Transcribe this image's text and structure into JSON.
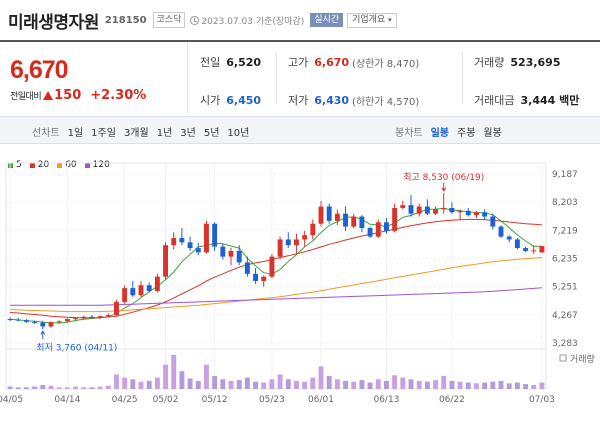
{
  "header": {
    "name": "미래생명자원",
    "code": "218150",
    "market": "코스닥",
    "date": "2023.07.03 기준(장마감)",
    "realtime_btn": "실시간",
    "company_btn": "기업개요"
  },
  "price": {
    "current": "6,670",
    "change_label": "전일대비",
    "change": "150",
    "change_pct": "+2.30%"
  },
  "stats": {
    "prev_close_label": "전일",
    "prev_close": "6,520",
    "high_label": "고가",
    "high": "6,670",
    "upper_limit_label": "(상한가",
    "upper_limit": "8,470)",
    "volume_label": "거래량",
    "volume": "523,695",
    "open_label": "시가",
    "open": "6,450",
    "low_label": "저가",
    "low": "6,430",
    "lower_limit_label": "(하한가",
    "lower_limit": "4,570)",
    "amount_label": "거래대금",
    "amount": "3,444 백만"
  },
  "tabs": {
    "line_label": "선차트",
    "line_tabs": [
      "1일",
      "1주일",
      "3개월",
      "1년",
      "3년",
      "5년",
      "10년"
    ],
    "candle_label": "봉차트",
    "candle_tabs": [
      "일봉",
      "주봉",
      "월봉"
    ]
  },
  "legend": [
    {
      "label": "5",
      "color": "#3aa63a"
    },
    {
      "label": "20",
      "color": "#d9342b"
    },
    {
      "label": "60",
      "color": "#f09a2a"
    },
    {
      "label": "120",
      "color": "#9b55d1"
    }
  ],
  "chart_data": {
    "type": "candlestick",
    "y_ticks": [
      "9,187",
      "8,203",
      "7,219",
      "6,235",
      "5,251",
      "4,267",
      "3,283"
    ],
    "y_range": [
      3283,
      9187
    ],
    "x_ticks": [
      "04/05",
      "04/14",
      "04/25",
      "05/02",
      "05/12",
      "05/23",
      "06/01",
      "06/13",
      "06/22",
      "07/03"
    ],
    "high_annotation": "최고 8,530 (06/19)",
    "low_annotation": "최저 3,760 (04/11)",
    "volume_label": "거래량",
    "up_color": "#d9342b",
    "down_color": "#1e61d2",
    "candles": [
      [
        4120,
        4180,
        4050,
        4100
      ],
      [
        4100,
        4160,
        4040,
        4080
      ],
      [
        4080,
        4120,
        3990,
        4020
      ],
      [
        4020,
        4070,
        3950,
        3990
      ],
      [
        3990,
        4060,
        3760,
        3860
      ],
      [
        3860,
        4040,
        3820,
        4010
      ],
      [
        4010,
        4080,
        3960,
        4040
      ],
      [
        4040,
        4150,
        4000,
        4120
      ],
      [
        4120,
        4180,
        4060,
        4150
      ],
      [
        4150,
        4230,
        4100,
        4200
      ],
      [
        4200,
        4260,
        4140,
        4180
      ],
      [
        4180,
        4240,
        4120,
        4220
      ],
      [
        4220,
        4320,
        4180,
        4260
      ],
      [
        4260,
        4800,
        4220,
        4720
      ],
      [
        4720,
        5300,
        4650,
        5200
      ],
      [
        5200,
        5450,
        4900,
        4950
      ],
      [
        4950,
        5450,
        4880,
        5300
      ],
      [
        5300,
        5400,
        5050,
        5100
      ],
      [
        5100,
        5700,
        5050,
        5600
      ],
      [
        5600,
        6800,
        5500,
        6700
      ],
      [
        6700,
        7150,
        6550,
        6950
      ],
      [
        6950,
        7300,
        6700,
        6800
      ],
      [
        6800,
        7000,
        6500,
        6600
      ],
      [
        6600,
        6780,
        6350,
        6450
      ],
      [
        6450,
        7550,
        6400,
        7450
      ],
      [
        7450,
        7500,
        6500,
        6650
      ],
      [
        6650,
        6750,
        6200,
        6300
      ],
      [
        6300,
        6600,
        6000,
        6500
      ],
      [
        6500,
        6700,
        6000,
        6100
      ],
      [
        6100,
        6300,
        5600,
        5700
      ],
      [
        5700,
        5900,
        5350,
        5450
      ],
      [
        5450,
        5650,
        5250,
        5600
      ],
      [
        5600,
        6400,
        5550,
        6300
      ],
      [
        6300,
        7000,
        6200,
        6900
      ],
      [
        6900,
        7150,
        6600,
        6700
      ],
      [
        6700,
        7100,
        6400,
        6900
      ],
      [
        6900,
        7200,
        6650,
        7050
      ],
      [
        7050,
        7600,
        6900,
        7450
      ],
      [
        7450,
        8250,
        7350,
        8050
      ],
      [
        8050,
        8150,
        7450,
        7550
      ],
      [
        7550,
        7950,
        7400,
        7800
      ],
      [
        7800,
        8050,
        7200,
        7350
      ],
      [
        7350,
        7800,
        7300,
        7700
      ],
      [
        7700,
        7750,
        7150,
        7300
      ],
      [
        7300,
        7350,
        6950,
        7000
      ],
      [
        7000,
        7600,
        6950,
        7500
      ],
      [
        7500,
        7650,
        7100,
        7200
      ],
      [
        7200,
        8150,
        7150,
        8000
      ],
      [
        8000,
        8250,
        7950,
        8100
      ],
      [
        8100,
        8450,
        7700,
        7800
      ],
      [
        7800,
        8150,
        7700,
        8050
      ],
      [
        8050,
        8300,
        7750,
        7800
      ],
      [
        7800,
        8050,
        7750,
        7950
      ],
      [
        7950,
        8530,
        7800,
        8000
      ],
      [
        8000,
        8200,
        7800,
        7850
      ],
      [
        7850,
        7950,
        7600,
        7900
      ],
      [
        7900,
        8000,
        7700,
        7750
      ],
      [
        7750,
        7900,
        7650,
        7850
      ],
      [
        7850,
        7950,
        7600,
        7700
      ],
      [
        7700,
        7800,
        7250,
        7350
      ],
      [
        7350,
        7400,
        6950,
        7000
      ],
      [
        7000,
        7050,
        6800,
        6900
      ],
      [
        6900,
        6950,
        6550,
        6600
      ],
      [
        6600,
        6650,
        6450,
        6500
      ],
      [
        6500,
        6700,
        6400,
        6520
      ],
      [
        6450,
        6670,
        6430,
        6670
      ]
    ],
    "volumes": [
      3,
      2,
      2,
      3,
      5,
      4,
      2,
      2,
      3,
      2,
      2,
      3,
      4,
      18,
      14,
      12,
      9,
      10,
      14,
      30,
      42,
      22,
      13,
      10,
      30,
      16,
      12,
      10,
      11,
      14,
      9,
      8,
      12,
      18,
      12,
      10,
      9,
      14,
      28,
      16,
      12,
      10,
      9,
      11,
      8,
      12,
      10,
      17,
      14,
      12,
      10,
      9,
      11,
      16,
      10,
      9,
      8,
      7,
      8,
      9,
      10,
      7,
      8,
      6,
      5,
      8
    ],
    "ma5": [
      4110,
      4090,
      4060,
      4040,
      4010,
      3990,
      3980,
      4010,
      4070,
      4110,
      4140,
      4170,
      4200,
      4310,
      4510,
      4660,
      4870,
      5080,
      5260,
      5490,
      5760,
      6120,
      6380,
      6640,
      6690,
      6760,
      6750,
      6670,
      6600,
      6240,
      5980,
      5740,
      5690,
      5850,
      6130,
      6370,
      6640,
      6850,
      7140,
      7390,
      7520,
      7670,
      7690,
      7600,
      7430,
      7410,
      7350,
      7470,
      7670,
      7740,
      7850,
      7950,
      7960,
      7990,
      7930,
      7900,
      7870,
      7830,
      7830,
      7760,
      7550,
      7310,
      7060,
      6850,
      6660,
      6660
    ],
    "ma20": [
      4350,
      4330,
      4300,
      4280,
      4250,
      4220,
      4200,
      4180,
      4170,
      4160,
      4160,
      4170,
      4190,
      4220,
      4290,
      4360,
      4440,
      4520,
      4610,
      4720,
      4860,
      5000,
      5140,
      5280,
      5450,
      5580,
      5700,
      5820,
      5930,
      6020,
      6080,
      6130,
      6200,
      6270,
      6330,
      6400,
      6470,
      6550,
      6640,
      6730,
      6800,
      6880,
      6950,
      7020,
      7080,
      7140,
      7200,
      7260,
      7320,
      7380,
      7430,
      7480,
      7520,
      7550,
      7570,
      7590,
      7600,
      7600,
      7590,
      7570,
      7540,
      7510,
      7480,
      7450,
      7430,
      7410
    ],
    "ma60": [
      4450,
      4440,
      4430,
      4420,
      4410,
      4400,
      4390,
      4380,
      4380,
      4380,
      4380,
      4380,
      4390,
      4400,
      4420,
      4440,
      4460,
      4480,
      4500,
      4520,
      4540,
      4560,
      4580,
      4600,
      4630,
      4660,
      4690,
      4720,
      4750,
      4780,
      4810,
      4840,
      4870,
      4900,
      4940,
      4980,
      5020,
      5060,
      5110,
      5160,
      5210,
      5260,
      5310,
      5360,
      5410,
      5460,
      5510,
      5560,
      5610,
      5660,
      5710,
      5760,
      5810,
      5860,
      5910,
      5960,
      6000,
      6040,
      6080,
      6120,
      6150,
      6180,
      6210,
      6230,
      6250,
      6270
    ],
    "ma120": [
      4600,
      4600,
      4600,
      4600,
      4600,
      4600,
      4600,
      4600,
      4600,
      4600,
      4600,
      4600,
      4610,
      4620,
      4630,
      4640,
      4650,
      4660,
      4670,
      4680,
      4690,
      4700,
      4710,
      4720,
      4730,
      4740,
      4750,
      4760,
      4770,
      4780,
      4790,
      4800,
      4810,
      4820,
      4830,
      4840,
      4850,
      4860,
      4870,
      4880,
      4890,
      4900,
      4910,
      4920,
      4930,
      4940,
      4950,
      4960,
      4970,
      4980,
      4990,
      5000,
      5010,
      5020,
      5030,
      5040,
      5050,
      5060,
      5070,
      5090,
      5110,
      5130,
      5150,
      5170,
      5190,
      5210
    ]
  }
}
